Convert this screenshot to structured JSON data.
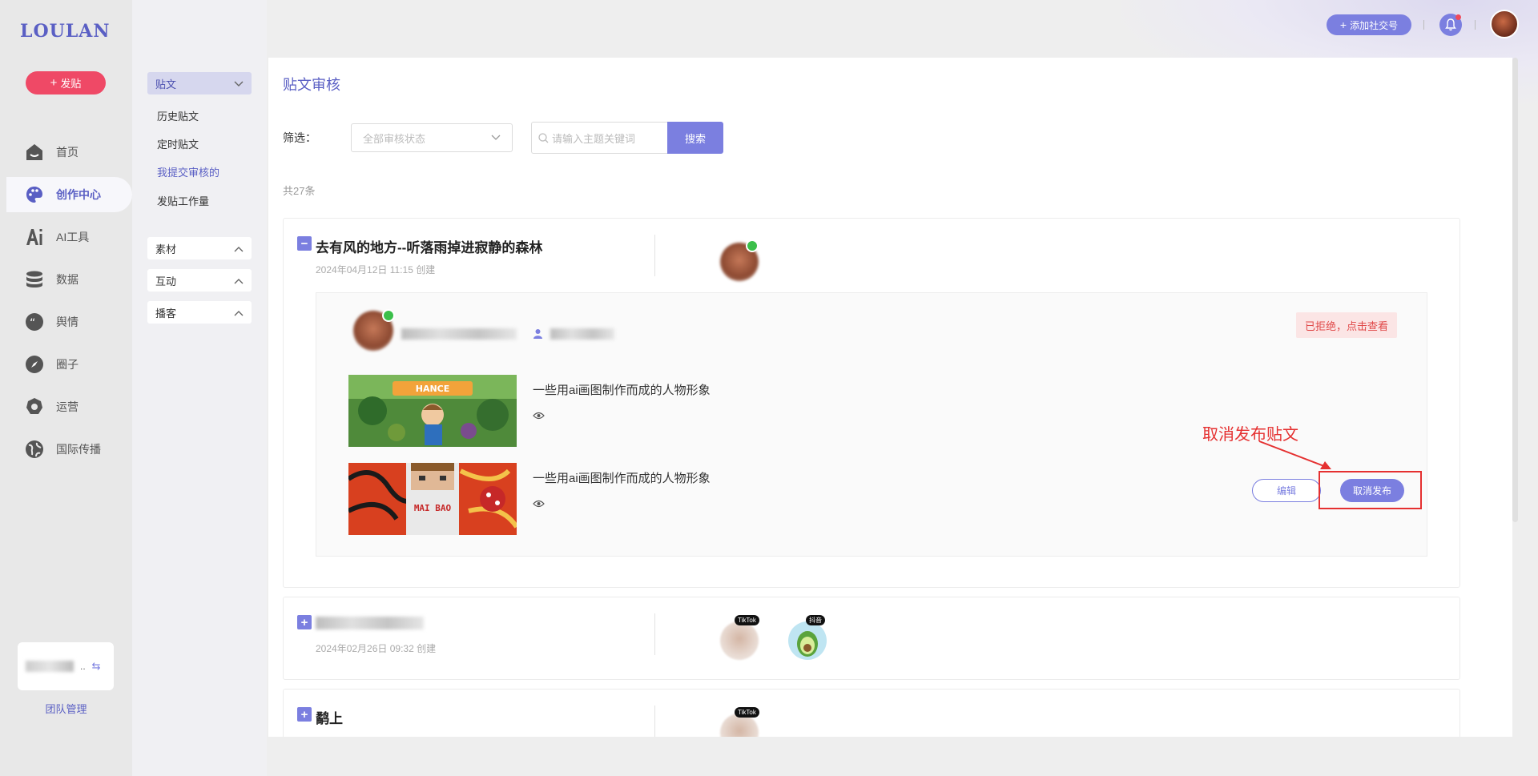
{
  "brand": {
    "logo": "LOULAN",
    "post_button": "发贴"
  },
  "nav": [
    {
      "label": "首页",
      "icon": "home-icon",
      "active": false
    },
    {
      "label": "创作中心",
      "icon": "palette-icon",
      "active": true
    },
    {
      "label": "AI工具",
      "icon": "ai-icon",
      "active": false
    },
    {
      "label": "数据",
      "icon": "database-icon",
      "active": false
    },
    {
      "label": "舆情",
      "icon": "quote-icon",
      "active": false
    },
    {
      "label": "圈子",
      "icon": "compass-icon",
      "active": false
    },
    {
      "label": "运营",
      "icon": "settings-icon",
      "active": false
    },
    {
      "label": "国际传播",
      "icon": "globe-icon",
      "active": false
    }
  ],
  "team": {
    "card_suffix": "..",
    "manage_link": "团队管理"
  },
  "subnav": {
    "group_post": "贴文",
    "links": [
      "历史贴文",
      "定时贴文",
      "我提交审核的",
      "发贴工作量"
    ],
    "group_material": "素材",
    "group_interaction": "互动",
    "group_broadcast": "播客"
  },
  "header": {
    "add_social": "添加社交号"
  },
  "page": {
    "title": "贴文审核",
    "filter_label": "筛选：",
    "select_placeholder": "全部审核状态",
    "search_placeholder": "请输入主题关键词",
    "search_button": "搜索",
    "total": "共27条"
  },
  "posts": [
    {
      "title": "去有风的地方--听落雨掉进寂静的森林",
      "created": "2024年04月12日 11:15 创建",
      "status": "已拒绝，点击查看",
      "items": [
        {
          "text": "一些用ai画图制作而成的人物形象",
          "thumb_label": "HANCE"
        },
        {
          "text": "一些用ai画图制作而成的人物形象",
          "thumb_label": "MAI BAO"
        }
      ],
      "edit_button": "编辑",
      "cancel_button": "取消发布"
    },
    {
      "created": "2024年02月26日 09:32 创建",
      "badges": [
        "TikTok",
        "抖音"
      ]
    },
    {
      "title": "鹬上",
      "badges": [
        "TikTok"
      ]
    }
  ],
  "annotation": {
    "text": "取消发布贴文",
    "color": "#e53030"
  },
  "colors": {
    "accent": "#7b7fe0",
    "brand": "#5a5fc4",
    "danger": "#ef4966"
  }
}
